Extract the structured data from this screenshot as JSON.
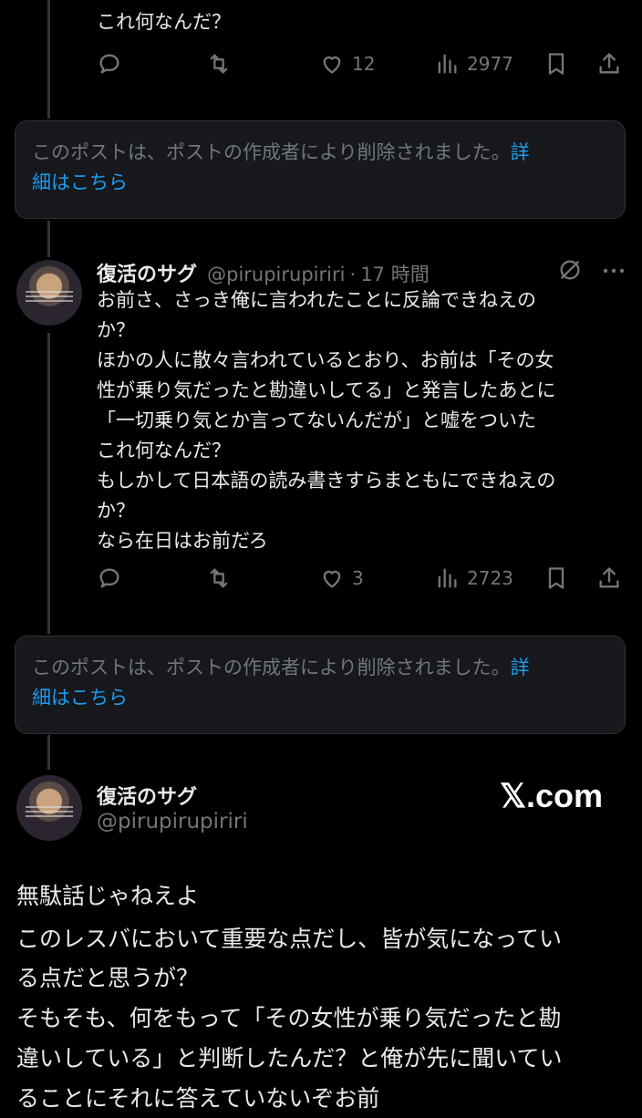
{
  "top_tweet": {
    "text_tail": "これ何なんだ？",
    "likes": "12",
    "views": "2977"
  },
  "deleted_notice": {
    "text": "このポストは、ポストの作成者により削除されました。",
    "link_part1": "詳",
    "link_part2": "細はこちら"
  },
  "reply": {
    "display_name": "復活のサグ",
    "handle": "@pirupirupiriri",
    "dot": "·",
    "time": "17 時間",
    "lines": [
      "お前さ、さっき俺に言われたことに反論できねえの",
      "か？",
      "ほかの人に散々言われているとおり、お前は「その女",
      "性が乗り気だったと勘違いしてる」と発言したあとに",
      "「一切乗り気とか言ってないんだが」と嘘をついた",
      "これ何なんだ？",
      "もしかして日本語の読み書きすらまともにできねえの",
      "か？",
      "なら在日はお前だろ"
    ],
    "likes": "3",
    "views": "2723"
  },
  "deleted_notice_2": {
    "text": "このポストは、ポストの作成者により削除されました。",
    "link_part1": "詳",
    "link_part2": "細はこちら"
  },
  "main_post": {
    "display_name": "復活のサグ",
    "handle": "@pirupirupiriri",
    "watermark": "𝕏.com",
    "lines": [
      "無駄話じゃねえよ",
      "このレスバにおいて重要な点だし、皆が気になってい",
      "る点だと思うが？",
      "そもそも、何をもって「その女性が乗り気だったと勘",
      "違いしている」と判断したんだ？と俺が先に聞いてい",
      "ることにそれに答えていないぞお前"
    ]
  },
  "icons": [
    "reply-icon",
    "retweet-icon",
    "like-icon",
    "views-icon",
    "bookmark-icon",
    "share-icon",
    "grok-icon",
    "more-icon"
  ]
}
